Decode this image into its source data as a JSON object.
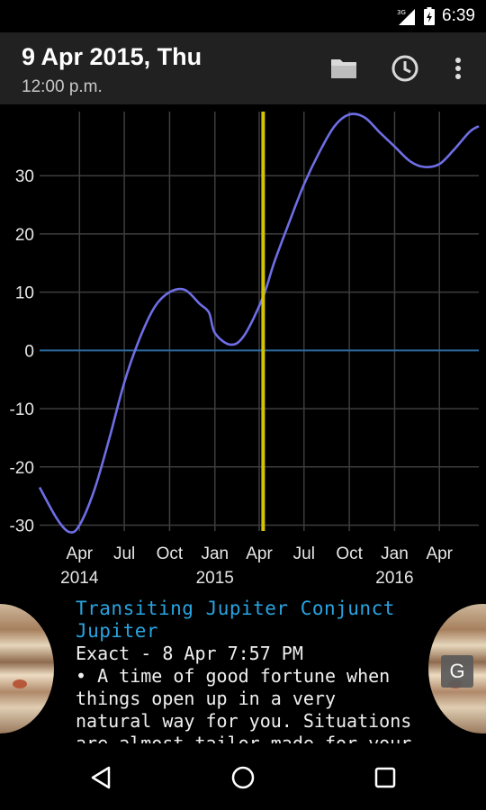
{
  "status": {
    "time": "6:39"
  },
  "header": {
    "date": "9 Apr 2015, Thu",
    "time": "12:00 p.m."
  },
  "icons": {
    "open": "folder-icon",
    "time": "clock-icon",
    "menu": "more-vert-icon",
    "globe": "G"
  },
  "chart_data": {
    "type": "line",
    "title": "",
    "xlabel": "",
    "ylabel": "",
    "ylim": [
      -31,
      41
    ],
    "grid": true,
    "y_ticks": [
      -30,
      -20,
      -10,
      0,
      10,
      20,
      30
    ],
    "x_ticks": [
      {
        "date": "2014-04-01",
        "label": "Apr",
        "year": "2014"
      },
      {
        "date": "2014-07-01",
        "label": "Jul",
        "year": ""
      },
      {
        "date": "2014-10-01",
        "label": "Oct",
        "year": ""
      },
      {
        "date": "2015-01-01",
        "label": "Jan",
        "year": "2015"
      },
      {
        "date": "2015-04-01",
        "label": "Apr",
        "year": ""
      },
      {
        "date": "2015-07-01",
        "label": "Jul",
        "year": ""
      },
      {
        "date": "2015-10-01",
        "label": "Oct",
        "year": ""
      },
      {
        "date": "2016-01-01",
        "label": "Jan",
        "year": "2016"
      },
      {
        "date": "2016-04-01",
        "label": "Apr",
        "year": ""
      }
    ],
    "x_range": [
      "2014-01-10",
      "2016-06-20"
    ],
    "current_date": "2015-04-09",
    "series": [
      {
        "color": "#6e6ee6",
        "x": [
          "2014-01-10",
          "2014-02-15",
          "2014-03-12",
          "2014-04-01",
          "2014-05-01",
          "2014-06-01",
          "2014-07-01",
          "2014-08-01",
          "2014-09-01",
          "2014-10-01",
          "2014-11-01",
          "2014-12-01",
          "2014-12-20",
          "2015-01-01",
          "2015-02-01",
          "2015-03-01",
          "2015-04-08",
          "2015-05-01",
          "2015-06-01",
          "2015-07-01",
          "2015-08-01",
          "2015-09-01",
          "2015-10-01",
          "2015-11-01",
          "2015-12-01",
          "2016-01-01",
          "2016-02-01",
          "2016-03-01",
          "2016-04-01",
          "2016-05-01",
          "2016-06-01",
          "2016-06-20"
        ],
        "y": [
          -23.5,
          -29,
          -31.2,
          -30,
          -24,
          -15,
          -5.5,
          2,
          7.5,
          10,
          10.4,
          8,
          6.5,
          3,
          1,
          2.5,
          9,
          15,
          22,
          28.5,
          34,
          38.5,
          40.5,
          40,
          37.5,
          35,
          32.5,
          31.5,
          32,
          34.5,
          37.5,
          38.5
        ]
      }
    ],
    "reference_line": {
      "y": 0,
      "color": "#2b6a9e"
    },
    "marker_color": "#d4c300"
  },
  "detail": {
    "title": "Transiting Jupiter Conjunct Jupiter",
    "exact": "Exact - 8 Apr 7:57 PM",
    "body": "• A time of good fortune when things open up in a very natural way for you. Situations are almost tailor made for your needs."
  }
}
